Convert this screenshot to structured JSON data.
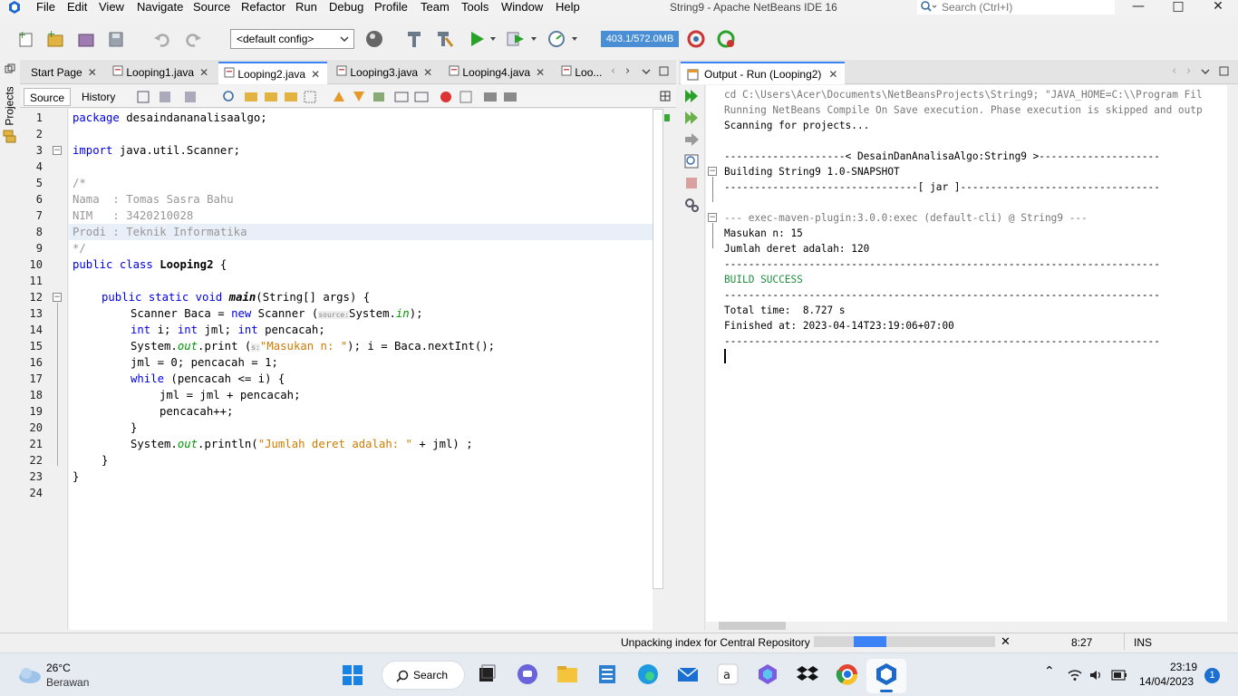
{
  "menubar": {
    "items": [
      "File",
      "Edit",
      "View",
      "Navigate",
      "Source",
      "Refactor",
      "Run",
      "Debug",
      "Profile",
      "Team",
      "Tools",
      "Window",
      "Help"
    ],
    "window_title": "String9 - Apache NetBeans IDE 16",
    "search_placeholder": "Search (Ctrl+I)"
  },
  "toolbar": {
    "config": "<default config>",
    "memory": "403.1/572.0MB"
  },
  "side_strip": {
    "projects_label": "Projects"
  },
  "editor": {
    "tabs": [
      {
        "label": "Start Page"
      },
      {
        "label": "Looping1.java"
      },
      {
        "label": "Looping2.java"
      },
      {
        "label": "Looping3.java"
      },
      {
        "label": "Looping4.java"
      },
      {
        "label": "Loo..."
      }
    ],
    "subtabs": {
      "source": "Source",
      "history": "History"
    },
    "line_numbers": [
      "1",
      "2",
      "3",
      "4",
      "5",
      "6",
      "7",
      "8",
      "9",
      "10",
      "11",
      "12",
      "13",
      "14",
      "15",
      "16",
      "17",
      "18",
      "19",
      "20",
      "21",
      "22",
      "23",
      "24"
    ],
    "code": {
      "l1_kw": "package",
      "l1_rest": " desaindananalisaalgo;",
      "l3_kw": "import",
      "l3_rest": " java.util.Scanner;",
      "l5": "/*",
      "l6": "Nama  : Tomas Sasra Bahu",
      "l7": "NIM   : 3420210028",
      "l8": "Prodi : Teknik Informatika",
      "l9": "*/",
      "l10_kw": "public class",
      "l10_name": " Looping2",
      "l10_rest": " {",
      "l12_kw": "public static void",
      "l12_name": " main",
      "l12_rest": "(String[] args) {",
      "l13_a": "Scanner Baca = ",
      "l13_kw": "new",
      "l13_b": " Scanner (",
      "l13_hint": "source:",
      "l13_c": "System.",
      "l13_field": "in",
      "l13_d": ");",
      "l14_kw1": "int",
      "l14_a": " i; ",
      "l14_kw2": "int",
      "l14_b": " jml; ",
      "l14_kw3": "int",
      "l14_c": " pencacah;",
      "l15_a": "System.",
      "l15_field": "out",
      "l15_b": ".print (",
      "l15_hint": "s:",
      "l15_str": "\"Masukan n: \"",
      "l15_c": "); i = Baca.nextInt();",
      "l16": "jml = 0; pencacah = 1;",
      "l17_kw": "while",
      "l17_rest": " (pencacah <= i) {",
      "l18": "jml = jml + pencacah;",
      "l19": "pencacah++;",
      "l20": "}",
      "l21_a": "System.",
      "l21_field": "out",
      "l21_b": ".println(",
      "l21_str": "\"Jumlah deret adalah: \"",
      "l21_c": " + jml) ;",
      "l22": "}",
      "l23": "}"
    }
  },
  "output": {
    "tab_label": "Output - Run (Looping2)",
    "lines": {
      "cd": "cd C:\\Users\\Acer\\Documents\\NetBeansProjects\\String9; \"JAVA_HOME=C:\\\\Program Fil",
      "running": "Running NetBeans Compile On Save execution. Phase execution is skipped and outp",
      "scanning": "Scanning for projects...",
      "header": "--------------------< DesainDanAnalisaAlgo:String9 >--------------------",
      "building": "Building String9 1.0-SNAPSHOT",
      "jar": "--------------------------------[ jar ]---------------------------------",
      "exec": "--- exec-maven-plugin:3.0.0:exec (default-cli) @ String9 ---",
      "masukan": "Masukan n: 15",
      "jumlah": "Jumlah deret adalah: 120",
      "sep1": "------------------------------------------------------------------------",
      "build_success": "BUILD SUCCESS",
      "sep2": "------------------------------------------------------------------------",
      "total_time": "Total time:  8.727 s",
      "finished": "Finished at: 2023-04-14T23:19:06+07:00",
      "sep3": "------------------------------------------------------------------------"
    }
  },
  "statusbar": {
    "message": "Unpacking index for Central Repository",
    "progress": 0.18,
    "position": "8:27",
    "mode": "INS"
  },
  "taskbar": {
    "weather_temp": "26°C",
    "weather_desc": "Berawan",
    "search_label": "Search",
    "time": "23:19",
    "date": "14/04/2023",
    "notification_count": "1"
  },
  "colors": {
    "accent": "#3b82f6",
    "keyword": "#0000e6",
    "comment": "#969696",
    "string": "#ce7b00",
    "success": "#1e8e3e"
  }
}
